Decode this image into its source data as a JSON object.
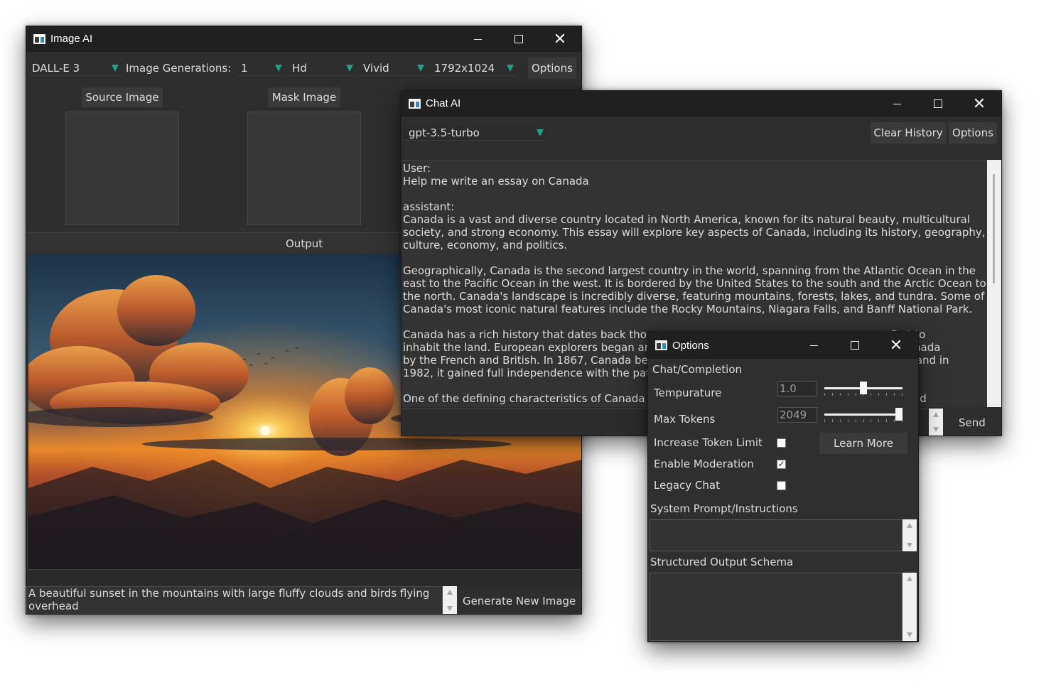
{
  "image_ai": {
    "title": "Image AI",
    "model": "DALL-E 3",
    "generations_label": "Image Generations:",
    "generations": "1",
    "quality": "Hd",
    "style": "Vivid",
    "size": "1792x1024",
    "options_label": "Options",
    "source_image_label": "Source Image",
    "mask_image_label": "Mask Image",
    "output_label": "Output",
    "prompt_line1": "A beautiful sunset in the mountains with large fluffy clouds and birds flying",
    "prompt_line2": "overhead",
    "generate_label": "Generate New Image"
  },
  "chat_ai": {
    "title": "Chat AI",
    "model": "gpt-3.5-turbo",
    "clear_history_label": "Clear History",
    "options_label": "Options",
    "send_label": "Send",
    "transcript": [
      "User:",
      "Help me write an essay on Canada",
      "",
      "assistant:",
      "Canada is a vast and diverse country located in North America, known for its natural beauty, multicultural",
      "society, and strong economy. This essay will explore key aspects of Canada, including its history, geography,",
      "culture, economy, and politics.",
      "",
      "Geographically, Canada is the second largest country in the world, spanning from the Atlantic Ocean in the",
      "east to the Pacific Ocean in the west. It is bordered by the United States to the south and the Arctic Ocean to",
      "the north. Canada's landscape is incredibly diverse, featuring mountains, forests, lakes, and tundra. Some of",
      "Canada's most iconic natural features include the Rocky Mountains, Niagara Falls, and Banff National Park.",
      "",
      "Canada has a rich history that dates back thou                                                                      first to",
      "inhabit the land. European explorers began arri                                                                    of Canada",
      "by the French and British. In 1867, Canada be                                                                    mpire, and in",
      "1982, it gained full independence with the patr",
      "",
      "One of the defining characteristics of Canada is                                                                  he world"
    ]
  },
  "options": {
    "title": "Options",
    "section_label": "Chat/Completion",
    "temperature_label": "Tempurature",
    "temperature_value": "1.0",
    "temperature_level": 0.5,
    "max_tokens_label": "Max Tokens",
    "max_tokens_value": "2049",
    "max_tokens_level": 1.0,
    "increase_token_limit_label": "Increase Token Limit",
    "increase_token_limit_checked": false,
    "learn_more_label": "Learn More",
    "enable_moderation_label": "Enable Moderation",
    "enable_moderation_checked": true,
    "legacy_chat_label": "Legacy Chat",
    "legacy_chat_checked": false,
    "system_prompt_label": "System Prompt/Instructions",
    "structured_output_label": "Structured Output Schema"
  }
}
